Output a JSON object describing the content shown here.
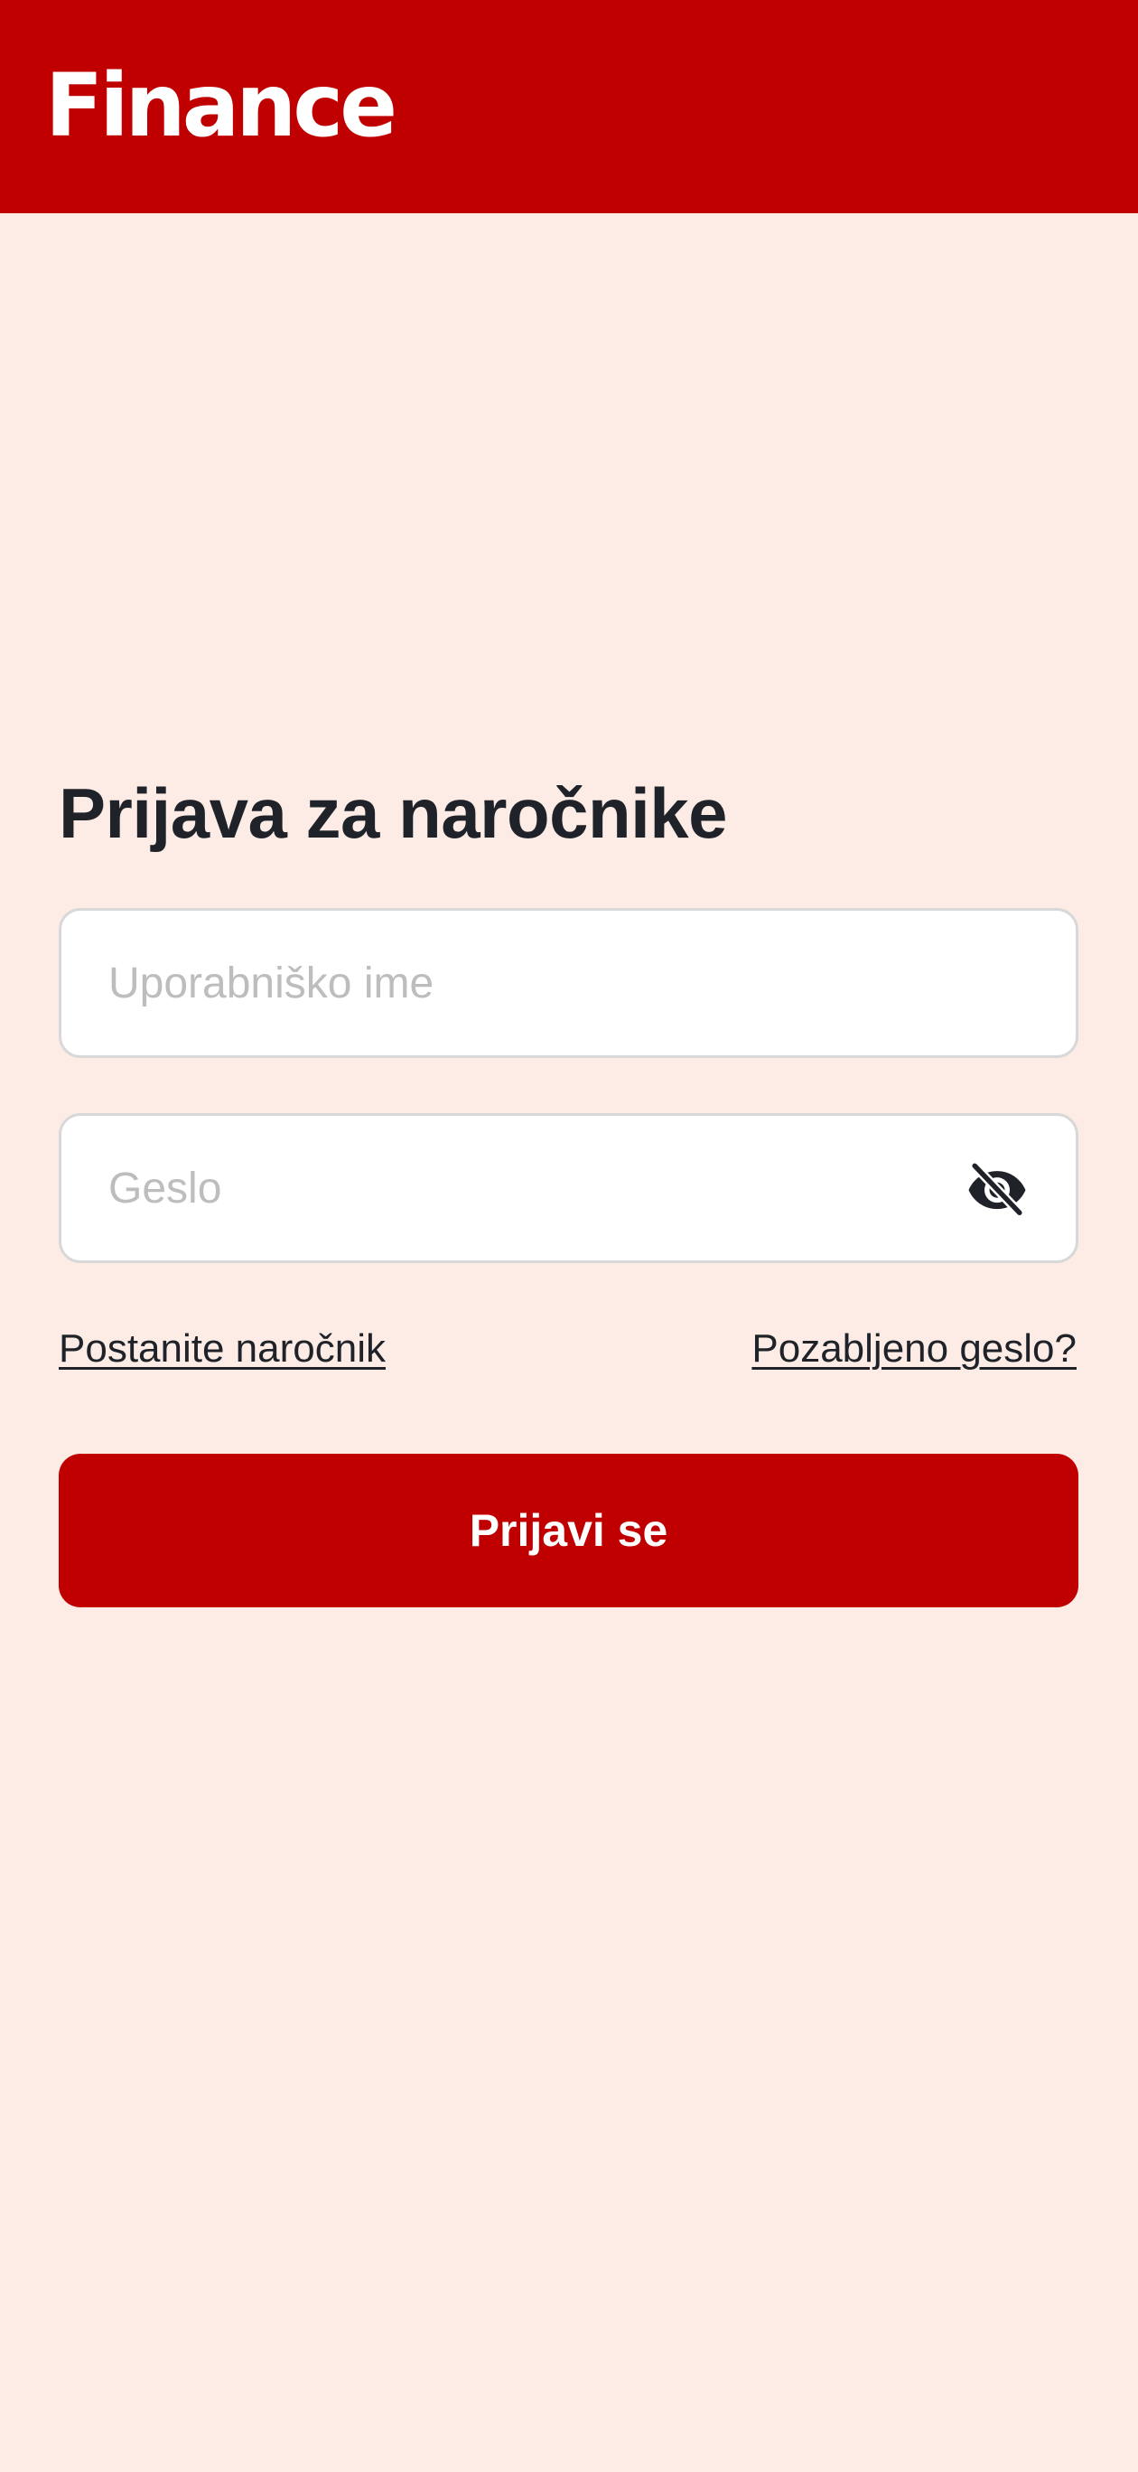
{
  "header": {
    "logo_text": "Finance",
    "brand_color": "#C00000"
  },
  "login": {
    "title": "Prijava za naročnike",
    "username": {
      "placeholder": "Uporabniško ime",
      "value": ""
    },
    "password": {
      "placeholder": "Geslo",
      "value": "",
      "toggle_icon": "eye-off-icon"
    },
    "subscribe_link": "Postanite naročnik",
    "forgot_link": "Pozabljeno geslo?",
    "submit_label": "Prijavi se"
  },
  "colors": {
    "background": "#FCECE5",
    "text": "#1F2329",
    "placeholder": "#BDBDBD",
    "field_border": "#D8D8D8"
  }
}
